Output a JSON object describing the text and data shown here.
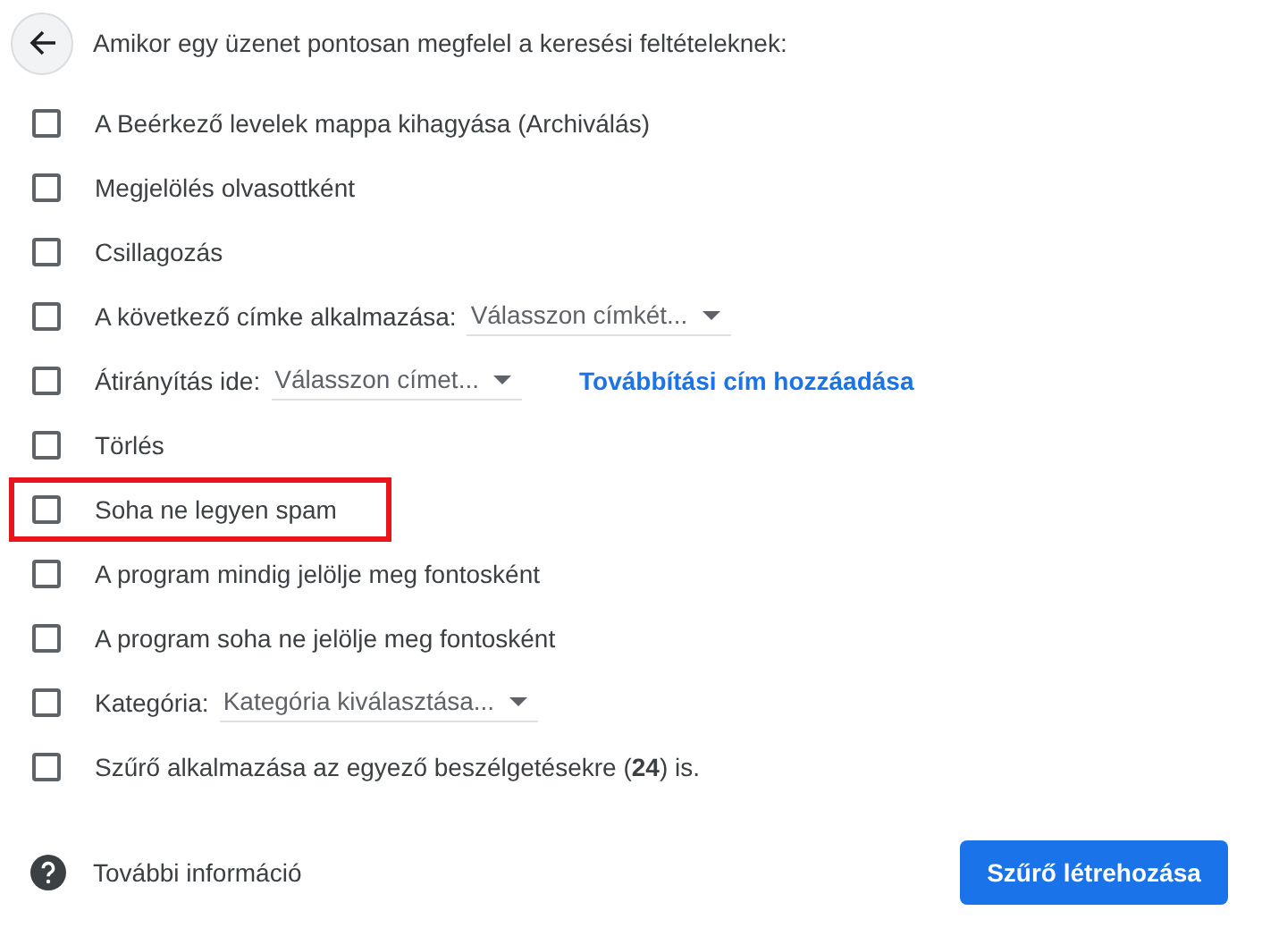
{
  "heading": "Amikor egy üzenet pontosan megfelel a keresési feltételeknek:",
  "rows": [
    {
      "kind": "plain",
      "label": "A Beérkező levelek mappa kihagyása (Archiválás)",
      "checked": false,
      "highlighted": false
    },
    {
      "kind": "plain",
      "label": "Megjelölés olvasottként",
      "checked": false,
      "highlighted": false
    },
    {
      "kind": "plain",
      "label": "Csillagozás",
      "checked": false,
      "highlighted": false
    },
    {
      "kind": "select",
      "label": "A következő címke alkalmazása:",
      "select": "Válasszon címkét...",
      "checked": false,
      "highlighted": false
    },
    {
      "kind": "select",
      "label": "Átirányítás ide:",
      "select": "Válasszon címet...",
      "link": "Továbbítási cím hozzáadása",
      "checked": false,
      "highlighted": false
    },
    {
      "kind": "plain",
      "label": "Törlés",
      "checked": false,
      "highlighted": false
    },
    {
      "kind": "plain",
      "label": "Soha ne legyen spam",
      "checked": false,
      "highlighted": true
    },
    {
      "kind": "plain",
      "label": "A program mindig jelölje meg fontosként",
      "checked": false,
      "highlighted": false
    },
    {
      "kind": "plain",
      "label": "A program soha ne jelölje meg fontosként",
      "checked": false,
      "highlighted": false
    },
    {
      "kind": "select",
      "label": "Kategória:",
      "select": "Kategória kiválasztása...",
      "checked": false,
      "highlighted": false
    },
    {
      "kind": "plain",
      "label": "Szűrő alkalmazása az egyező beszélgetésekre (**24**) is.",
      "checked": false,
      "highlighted": false
    }
  ],
  "help_link": "További információ",
  "create_button": "Szűrő létrehozása"
}
